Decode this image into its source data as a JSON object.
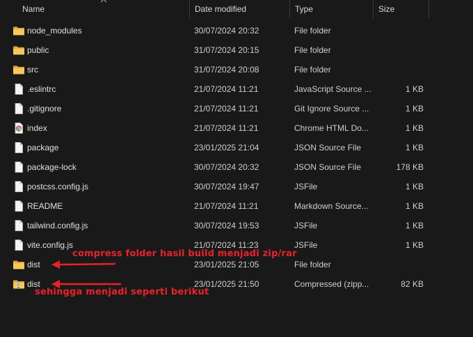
{
  "columns": {
    "name": "Name",
    "date": "Date modified",
    "type": "Type",
    "size": "Size"
  },
  "rows": [
    {
      "name": "node_modules",
      "date": "30/07/2024 20:32",
      "type": "File folder",
      "size": "",
      "icon": "folder-icon"
    },
    {
      "name": "public",
      "date": "31/07/2024 20:15",
      "type": "File folder",
      "size": "",
      "icon": "folder-icon"
    },
    {
      "name": "src",
      "date": "31/07/2024 20:08",
      "type": "File folder",
      "size": "",
      "icon": "folder-icon"
    },
    {
      "name": ".eslintrc",
      "date": "21/07/2024 11:21",
      "type": "JavaScript Source ...",
      "size": "1 KB",
      "icon": "file-icon"
    },
    {
      "name": ".gitignore",
      "date": "21/07/2024 11:21",
      "type": "Git Ignore Source ...",
      "size": "1 KB",
      "icon": "file-icon"
    },
    {
      "name": "index",
      "date": "21/07/2024 11:21",
      "type": "Chrome HTML Do...",
      "size": "1 KB",
      "icon": "chrome-html-icon"
    },
    {
      "name": "package",
      "date": "23/01/2025 21:04",
      "type": "JSON Source File",
      "size": "1 KB",
      "icon": "file-icon"
    },
    {
      "name": "package-lock",
      "date": "30/07/2024 20:32",
      "type": "JSON Source File",
      "size": "178 KB",
      "icon": "file-icon"
    },
    {
      "name": "postcss.config.js",
      "date": "30/07/2024 19:47",
      "type": "JSFile",
      "size": "1 KB",
      "icon": "file-icon"
    },
    {
      "name": "README",
      "date": "21/07/2024 11:21",
      "type": "Markdown Source...",
      "size": "1 KB",
      "icon": "file-icon"
    },
    {
      "name": "tailwind.config.js",
      "date": "30/07/2024 19:53",
      "type": "JSFile",
      "size": "1 KB",
      "icon": "file-icon"
    },
    {
      "name": "vite.config.js",
      "date": "21/07/2024 11:23",
      "type": "JSFile",
      "size": "1 KB",
      "icon": "file-icon"
    },
    {
      "name": "dist",
      "date": "23/01/2025 21:05",
      "type": "File folder",
      "size": "",
      "icon": "folder-icon"
    },
    {
      "name": "dist",
      "date": "23/01/2025 21:50",
      "type": "Compressed (zipp...",
      "size": "82 KB",
      "icon": "zip-folder-icon"
    }
  ],
  "annotations": {
    "compress": "compress folder hasil build menjadi zip/rar",
    "result": "sehingga menjadi seperti berikut"
  },
  "colors": {
    "background": "#191919",
    "folder": "#f2c14e",
    "annotation": "#e8222a"
  }
}
